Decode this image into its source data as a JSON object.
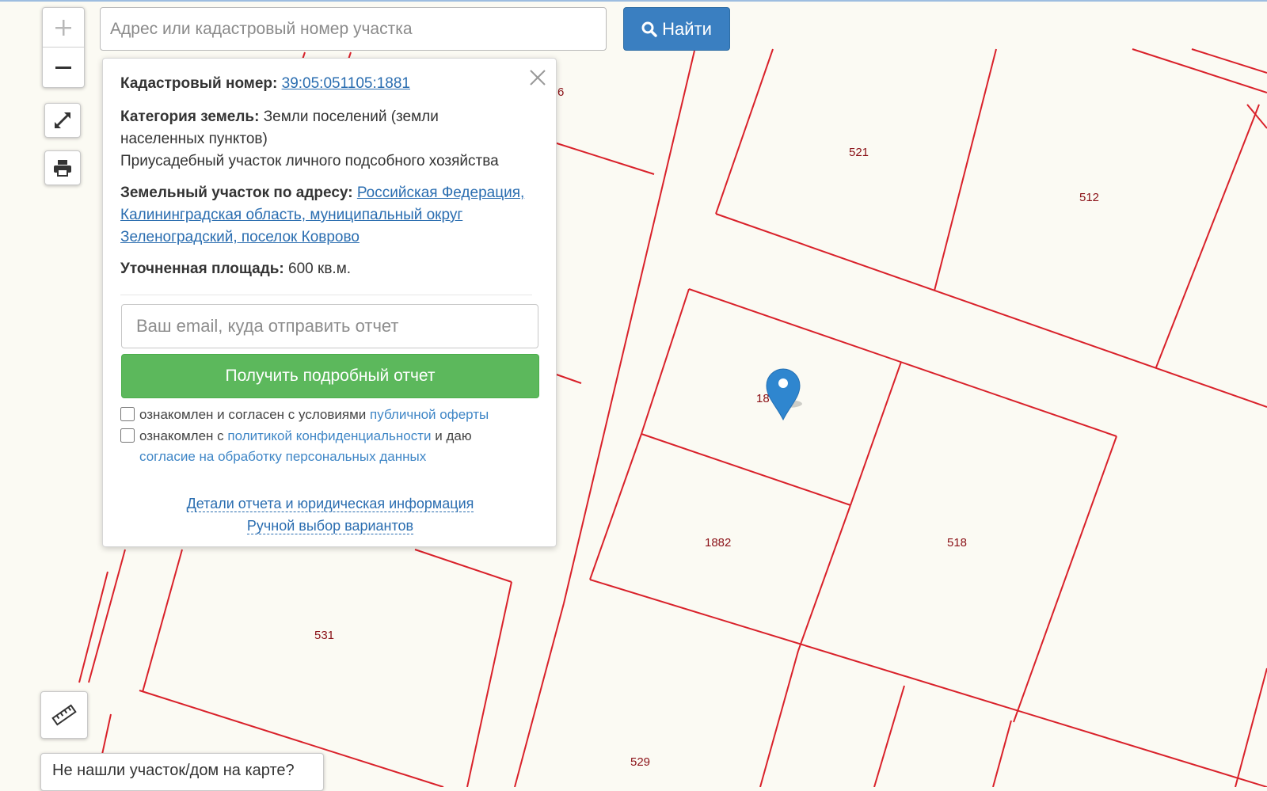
{
  "search": {
    "placeholder": "Адрес или кадастровый номер участка",
    "button_label": "Найти"
  },
  "controls": {
    "zoom_in": "+",
    "zoom_out": "−"
  },
  "popup": {
    "cadastral_label": "Кадастровый номер:",
    "cadastral_number": "39:05:051105:1881",
    "category_label": "Категория земель:",
    "category_value": "Земли поселений (земли населенных пунктов)",
    "usage": "Приусадебный участок личного подсобного хозяйства",
    "address_label": "Земельный участок по адресу:",
    "address_value": "Российская Федерация, Калининградская область, муниципальный округ Зеленоградский, поселок Коврово",
    "area_label": "Уточненная площадь:",
    "area_value": "600 кв.м.",
    "email_placeholder": "Ваш email, куда отправить отчет",
    "report_button": "Получить подробный отчет",
    "consent1_text": "ознакомлен и согласен с условиями",
    "consent1_link": "публичной оферты",
    "consent2_text_a": "ознакомлен с",
    "consent2_link_a": "политикой конфиденциальности",
    "consent2_text_b": "и даю",
    "consent2_link_b": "согласие на обработку персональных данных",
    "details_link": "Детали отчета и юридическая информация",
    "manual_link": "Ручной выбор вариантов"
  },
  "map": {
    "parcel_labels": [
      "521",
      "512",
      "1882",
      "518",
      "531",
      "529",
      "18",
      "6"
    ],
    "line_color": "#d9212a",
    "label_color": "#8a1016",
    "marker_color": "#2f86cf"
  },
  "not_found_button": "Не нашли участок/дом на карте?"
}
